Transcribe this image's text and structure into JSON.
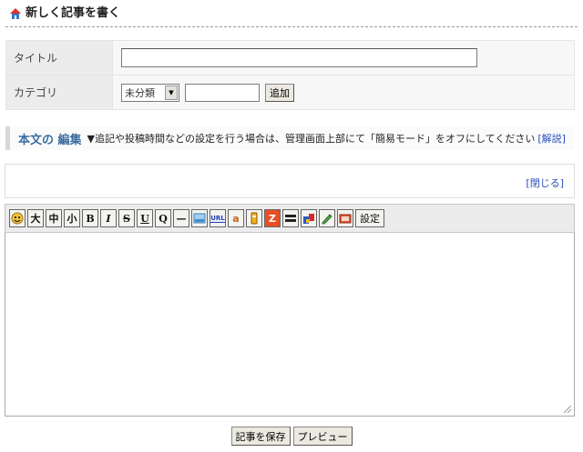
{
  "header": {
    "title": "新しく記事を書く",
    "icon": "home-icon"
  },
  "form": {
    "title_label": "タイトル",
    "title_value": "",
    "category_label": "カテゴリ",
    "category_selected": "未分類",
    "new_category_value": "",
    "add_button": "追加"
  },
  "edit_section": {
    "heading": "本文の 編集",
    "note": "▼追記や投稿時間などの設定を行う場合は、管理画面上部にて「簡易モード」をオフにしてください",
    "help_link": "[解説]"
  },
  "panel": {
    "close_link": "[閉じる]"
  },
  "toolbar": {
    "items": [
      {
        "name": "emoji-icon"
      },
      {
        "name": "size-large",
        "label": "大"
      },
      {
        "name": "size-medium",
        "label": "中"
      },
      {
        "name": "size-small",
        "label": "小"
      },
      {
        "name": "bold",
        "label": "B"
      },
      {
        "name": "italic",
        "label": "I"
      },
      {
        "name": "strike",
        "label": "S"
      },
      {
        "name": "underline",
        "label": "U"
      },
      {
        "name": "quote",
        "label": "Q"
      },
      {
        "name": "hr",
        "label": "—"
      },
      {
        "name": "image-icon"
      },
      {
        "name": "url-icon",
        "label": "URL"
      },
      {
        "name": "amazon-icon",
        "label": "a"
      },
      {
        "name": "file-icon"
      },
      {
        "name": "zip-icon",
        "label": "Z"
      },
      {
        "name": "more-icon"
      },
      {
        "name": "color-icon"
      },
      {
        "name": "pen-icon"
      },
      {
        "name": "pcs-icon"
      }
    ],
    "settings_label": "設定"
  },
  "editor": {
    "body": ""
  },
  "footer": {
    "save_button": "記事を保存",
    "preview_button": "プレビュー"
  },
  "colors": {
    "heading_blue": "#3a6d9f",
    "link_blue": "#2a4fbb",
    "label_bg": "#ececec"
  }
}
